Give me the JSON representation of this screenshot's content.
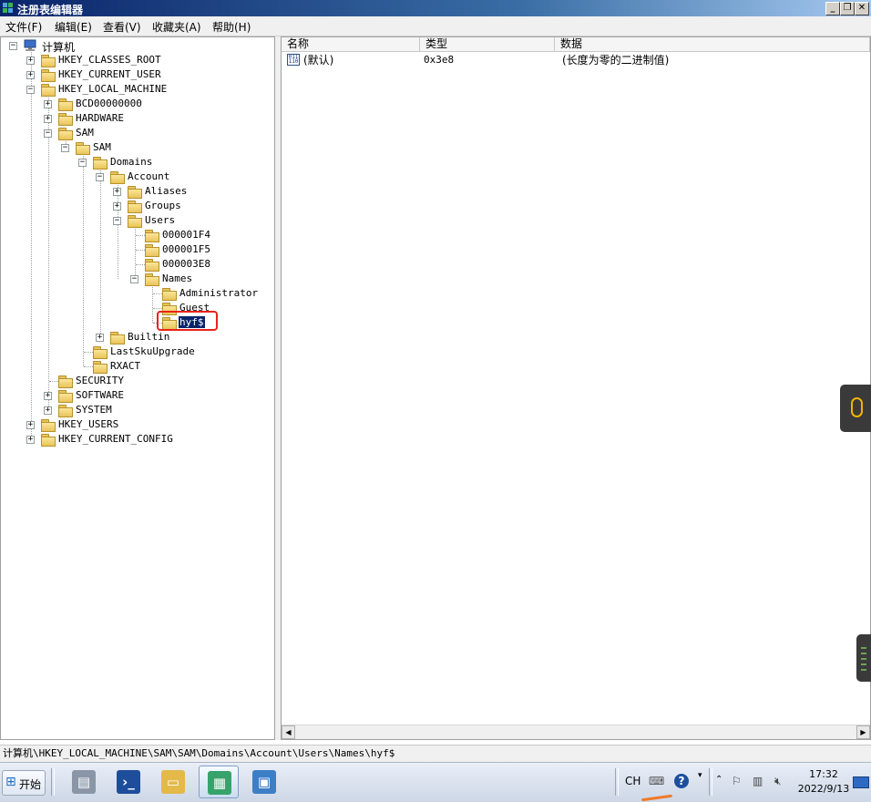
{
  "window": {
    "title": "注册表编辑器",
    "icon": "regedit-icon",
    "controls": {
      "minimize": "_",
      "restore": "❐",
      "close": "✕"
    }
  },
  "menu": {
    "file": "文件(F)",
    "edit": "编辑(E)",
    "view": "查看(V)",
    "favorites": "收藏夹(A)",
    "help": "帮助(H)"
  },
  "tree": {
    "computer": "计算机",
    "hkcr": "HKEY_CLASSES_ROOT",
    "hkcu": "HKEY_CURRENT_USER",
    "hklm": "HKEY_LOCAL_MACHINE",
    "bcd": "BCD00000000",
    "hardware": "HARDWARE",
    "sam": "SAM",
    "sam_sub": "SAM",
    "domains": "Domains",
    "account": "Account",
    "aliases": "Aliases",
    "groups": "Groups",
    "users": "Users",
    "u1f4": "000001F4",
    "u1f5": "000001F5",
    "u3e8": "000003E8",
    "names": "Names",
    "administrator": "Administrator",
    "guest": "Guest",
    "hyf": "hyf$",
    "builtin": "Builtin",
    "lastsku": "LastSkuUpgrade",
    "rxact": "RXACT",
    "security": "SECURITY",
    "software": "SOFTWARE",
    "system": "SYSTEM",
    "hku": "HKEY_USERS",
    "hkcc": "HKEY_CURRENT_CONFIG",
    "selected": "hyf$"
  },
  "list": {
    "columns": {
      "name": "名称",
      "type": "类型",
      "data": "数据"
    },
    "rows": [
      {
        "name": "(默认)",
        "type": "0x3e8",
        "data": "(长度为零的二进制值)"
      }
    ]
  },
  "status": {
    "path": "计算机\\HKEY_LOCAL_MACHINE\\SAM\\SAM\\Domains\\Account\\Users\\Names\\hyf$"
  },
  "taskbar": {
    "start_label": "开始",
    "apps": [
      "server-manager-icon",
      "powershell-icon",
      "explorer-icon",
      "regedit-icon",
      "control-panel-icon"
    ],
    "tray": {
      "lang": "CH",
      "time": "17:32",
      "date": "2022/9/13"
    }
  },
  "colors": {
    "title_gradient_start": "#0a246a",
    "selection": "#0a246a",
    "highlight_box": "#e8231a"
  }
}
